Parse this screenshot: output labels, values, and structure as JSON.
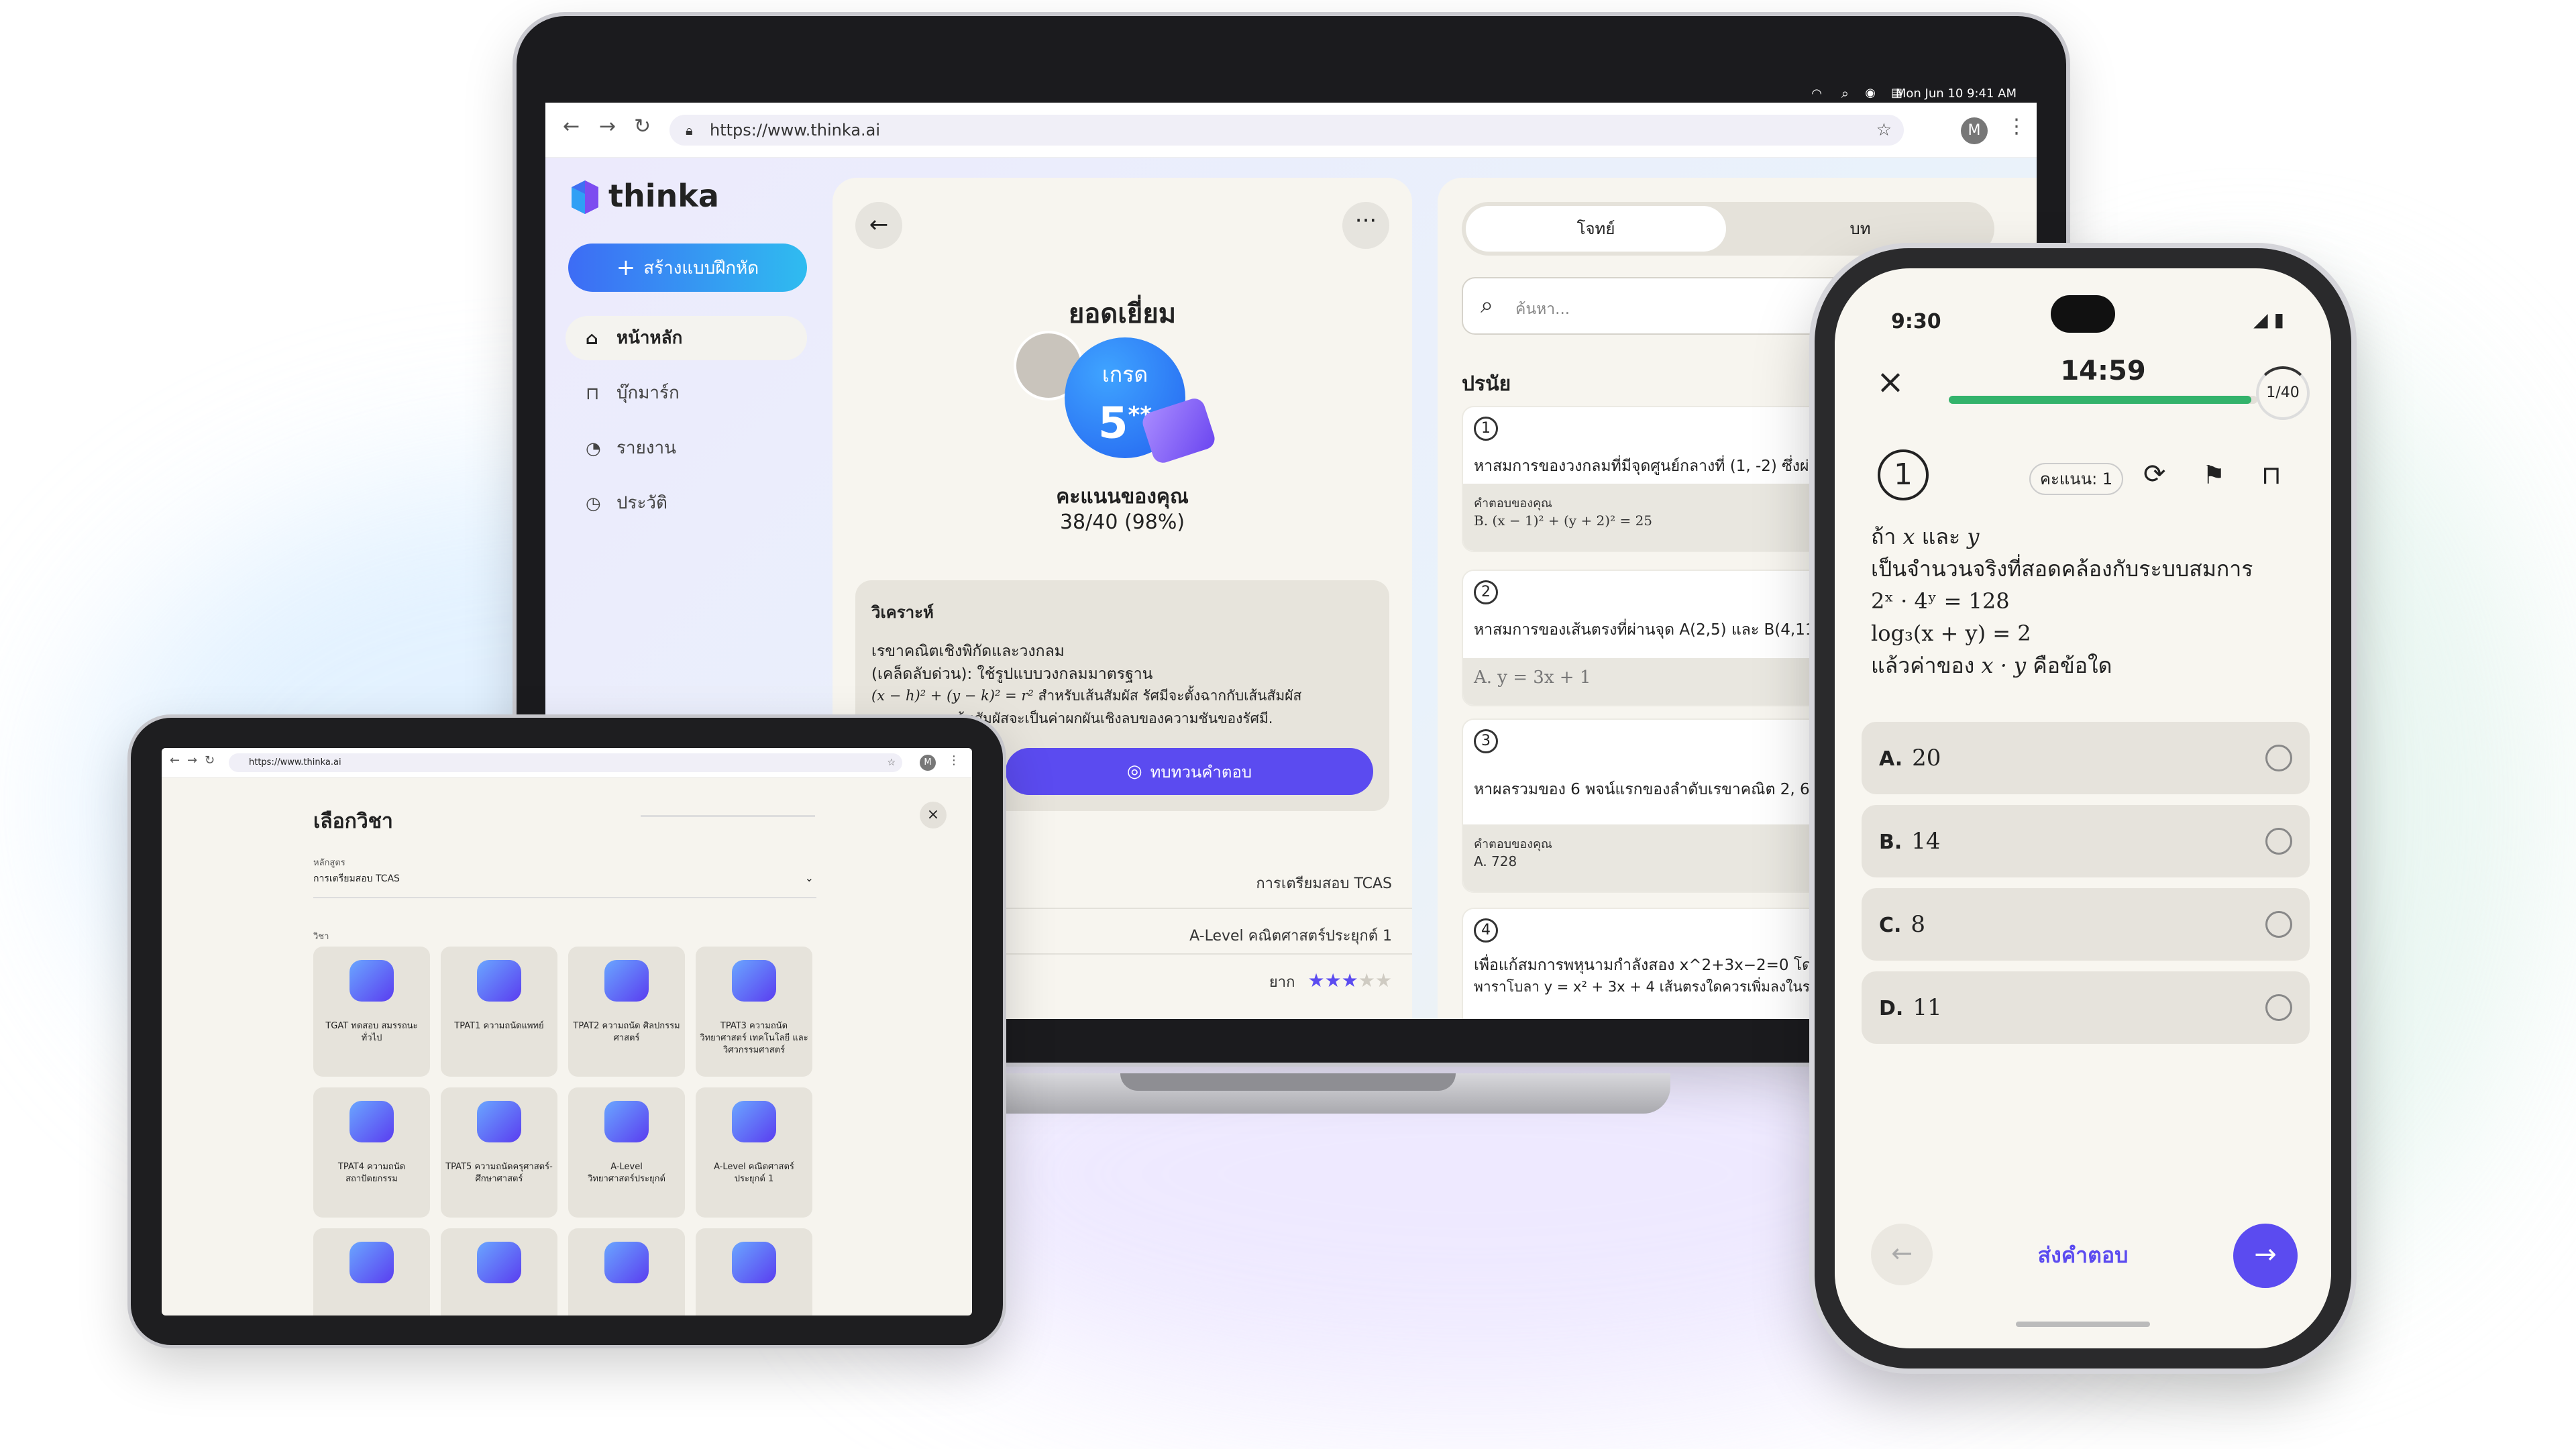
{
  "laptop": {
    "menubar": {
      "date": "Mon Jun 10  9:41 AM"
    },
    "browser": {
      "url": "https://www.thinka.ai",
      "avatar": "M"
    },
    "sidebar": {
      "brand": "thinka",
      "create_button": "สร้างแบบฝึกหัด",
      "items": [
        {
          "label": "หน้าหลัก",
          "icon": "home-icon",
          "active": true
        },
        {
          "label": "บุ๊กมาร์ก",
          "icon": "bookmark-icon",
          "active": false
        },
        {
          "label": "รายงาน",
          "icon": "report-icon",
          "active": false
        },
        {
          "label": "ประวัติ",
          "icon": "history-icon",
          "active": false
        }
      ]
    },
    "result": {
      "title": "ยอดเยี่ยม",
      "grade_label": "เกรด",
      "grade_value": "5",
      "grade_stars": "**",
      "score_label": "คะแนนของคุณ",
      "score_value": "38/40 (98%)",
      "analysis_title": "วิเคราะห์",
      "analysis_line1": "เรขาคณิตเชิงพิกัดและวงกลม",
      "analysis_line2": "(เคล็ดลับด่วน): ใช้รูปแบบวงกลมมาตรฐาน",
      "analysis_formula": "(x − h)² + (y − k)² = r²",
      "analysis_line3": "สำหรับเส้นสัมผัส รัศมีจะตั้งฉากกับเส้นสัมผัส",
      "analysis_line4": "ระยะทางจากเส้นสัมผัสจะเป็นค่าผกผันเชิงลบของความชันของรัศมี.",
      "review_button": "ทบทวนคำตอบ",
      "meta": [
        {
          "value": "การเตรียมสอบ TCAS"
        },
        {
          "value": "A-Level คณิตศาสตร์ประยุกต์ 1"
        }
      ],
      "difficulty_label": "ยาก",
      "difficulty_stars": 3,
      "difficulty_max": 5
    },
    "questions_panel": {
      "tabs": [
        {
          "label": "โจทย์",
          "active": true
        },
        {
          "label": "บท",
          "active": false
        }
      ],
      "search_placeholder": "ค้นหา...",
      "section": "ปรนัย",
      "answer_label": "คำตอบของคุณ",
      "items": [
        {
          "num": "1",
          "text": "หาสมการของวงกลมที่มีจุดศูนย์กลางที่ (1, -2) ซึ่งผ่านจุ",
          "answer": "B. (x − 1)² + (y + 2)² = 25",
          "has_label": true
        },
        {
          "num": "2",
          "text": "หาสมการของเส้นตรงที่ผ่านจุด A(2,5) และ B(4,11).",
          "answer": "A. y = 3x + 1",
          "has_label": false
        },
        {
          "num": "3",
          "text": "หาผลรวมของ 6 พจน์แรกของลำดับเรขาคณิต 2, 6, 18,",
          "answer": "A. 728",
          "has_label": true
        },
        {
          "num": "4",
          "text": "เพื่อแก้สมการพหุนามกำลังสอง x^2+3x−2=0 โดยใช้กร",
          "text2": "พาราโบลา y = x² + 3x + 4 เส้นตรงใดควรเพิ่มลงในระ",
          "answer": "",
          "has_label": false
        }
      ]
    }
  },
  "tablet": {
    "browser": {
      "url": "https://www.thinka.ai",
      "avatar": "M"
    },
    "title": "เลือกวิชา",
    "course_label": "หลักสูตร",
    "course_value": "การเตรียมสอบ TCAS",
    "subject_label": "วิชา",
    "subjects": [
      {
        "label": "TGAT ทดสอบ สมรรถนะทั่วไป"
      },
      {
        "label": "TPAT1 ความถนัดแพทย์"
      },
      {
        "label": "TPAT2 ความถนัด ศิลปกรรมศาสตร์"
      },
      {
        "label": "TPAT3 ความถนัด วิทยาศาสตร์ เทคโนโลยี และวิศวกรรมศาสตร์"
      },
      {
        "label": "TPAT4 ความถนัด สถาปัตยกรรม"
      },
      {
        "label": "TPAT5 ความถนัดครุศาสตร์- ศึกษาศาสตร์"
      },
      {
        "label": "A-Level วิทยาศาสตร์ประยุกต์"
      },
      {
        "label": "A-Level คณิตศาสตร์ประยุกต์ 1"
      }
    ]
  },
  "phone": {
    "status_time": "9:30",
    "timer": "14:59",
    "progress": 0.98,
    "progress_count": "1/40",
    "question_number": "1",
    "points": "คะแนน: 1",
    "question": {
      "line1a": "ถ้า",
      "var_x": "x",
      "line1b": "และ",
      "var_y": "y",
      "line2": "เป็นจำนวนจริงที่สอดคล้องกับระบบสมการ",
      "eq1": "2ˣ · 4ʸ = 128",
      "eq2": "log₃(x + y) = 2",
      "line3a": "แล้วค่าของ",
      "expr": "x · y",
      "line3b": "คือข้อใด"
    },
    "options": [
      {
        "key": "A.",
        "value": "20"
      },
      {
        "key": "B.",
        "value": "14"
      },
      {
        "key": "C.",
        "value": "8"
      },
      {
        "key": "D.",
        "value": "11"
      }
    ],
    "submit": "ส่งคำตอบ"
  },
  "colors": {
    "accent": "#5b4bf0",
    "green": "#33b36b",
    "blue": "#2f8cf3"
  }
}
